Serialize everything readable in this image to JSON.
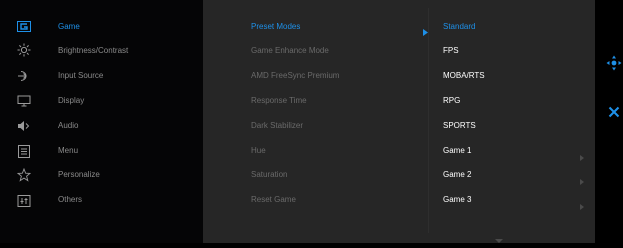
{
  "main_menu": {
    "items": [
      {
        "label": "Game",
        "icon": "gamepad-icon",
        "active": true
      },
      {
        "label": "Brightness/Contrast",
        "icon": "sun-icon",
        "active": false
      },
      {
        "label": "Input Source",
        "icon": "input-source-icon",
        "active": false
      },
      {
        "label": "Display",
        "icon": "monitor-icon",
        "active": false
      },
      {
        "label": "Audio",
        "icon": "speaker-icon",
        "active": false
      },
      {
        "label": "Menu",
        "icon": "menu-icon",
        "active": false
      },
      {
        "label": "Personalize",
        "icon": "star-icon",
        "active": false
      },
      {
        "label": "Others",
        "icon": "others-icon",
        "active": false
      }
    ]
  },
  "game_submenu": {
    "items": [
      {
        "label": "Preset Modes",
        "active": true
      },
      {
        "label": "Game Enhance Mode",
        "active": false
      },
      {
        "label": "AMD FreeSync Premium",
        "active": false
      },
      {
        "label": "Response Time",
        "active": false
      },
      {
        "label": "Dark Stabilizer",
        "active": false
      },
      {
        "label": "Hue",
        "active": false
      },
      {
        "label": "Saturation",
        "active": false
      },
      {
        "label": "Reset Game",
        "active": false
      }
    ]
  },
  "preset_modes": {
    "options": [
      {
        "label": "Standard",
        "selected": true
      },
      {
        "label": "FPS",
        "selected": false
      },
      {
        "label": "MOBA/RTS",
        "selected": false
      },
      {
        "label": "RPG",
        "selected": false
      },
      {
        "label": "SPORTS",
        "selected": false
      },
      {
        "label": "Game 1",
        "selected": false
      },
      {
        "label": "Game 2",
        "selected": false
      },
      {
        "label": "Game 3",
        "selected": false
      }
    ]
  },
  "navigation": {
    "joystick_icon": "joystick-move-icon",
    "exit_icon": "close-icon"
  },
  "colors": {
    "accent": "#1e90e8",
    "panel": "#262626",
    "left_panel": "#050506"
  }
}
